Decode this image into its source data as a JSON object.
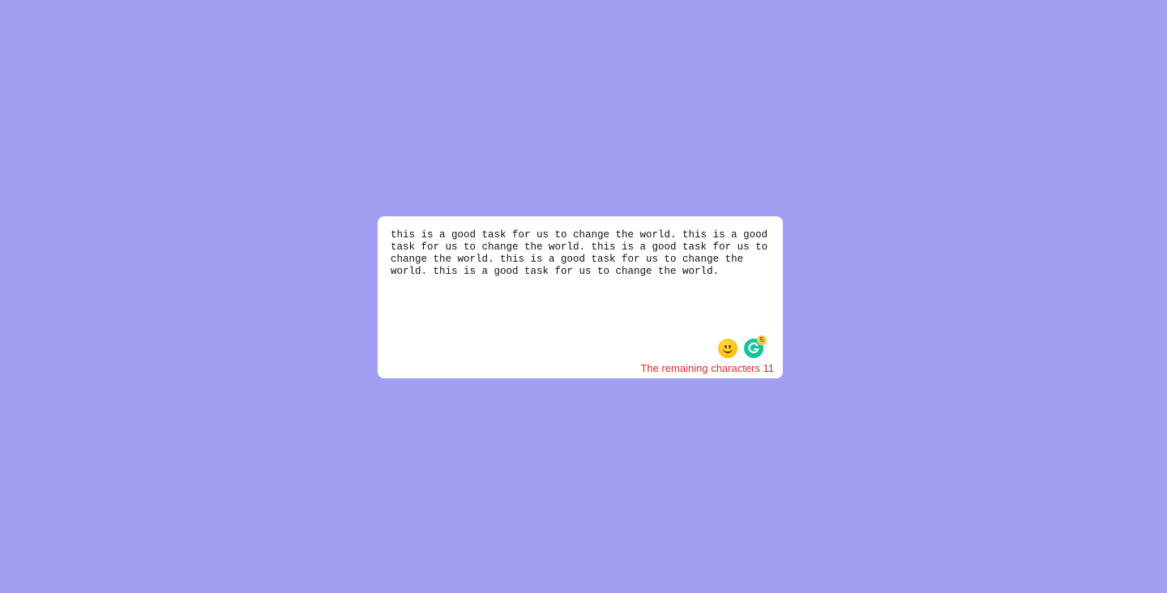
{
  "editor": {
    "text": "this is a good task for us to change the world. this is a good task for us to change the world. this is a good task for us to change the world. this is a good task for us to change the world. this is a good task for us to change the world."
  },
  "icons": {
    "emoji": "smiley-face-icon",
    "grammarly": "grammarly-icon",
    "grammarly_badge": "5"
  },
  "counter": {
    "label": "The remaining characters 11"
  },
  "colors": {
    "background": "#a09ff1",
    "card": "#ffffff",
    "counter_text": "#e32b2b",
    "grammarly": "#15c39a"
  }
}
